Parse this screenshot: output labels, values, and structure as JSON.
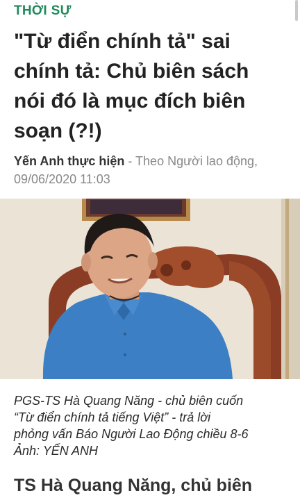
{
  "category": "THỜI SỰ",
  "headline": "\"Từ điển chính tả\" sai chính tả: Chủ biên sách nói đó là mục đích biên soạn (?!)",
  "byline": {
    "author": "Yến Anh thực hiện",
    "source": " - Theo Người lao động,",
    "datetime": "09/06/2020 11:03"
  },
  "photo": {
    "description_icon": "photo-image"
  },
  "caption": {
    "line1": "PGS-TS Hà Quang Năng - chủ biên cuốn",
    "line2": "“Từ điển chính tả tiếng Việt” - trả lời",
    "line3": "phỏng vấn Báo Người Lao Động chiều 8-6",
    "line4": "Ảnh: YẾN ANH"
  },
  "next_headline": "TS Hà Quang Năng, chủ biên",
  "colors": {
    "category": "#1f8a5b",
    "headline": "#222222",
    "byline": "#888888",
    "shirt": "#3d7fc4"
  }
}
